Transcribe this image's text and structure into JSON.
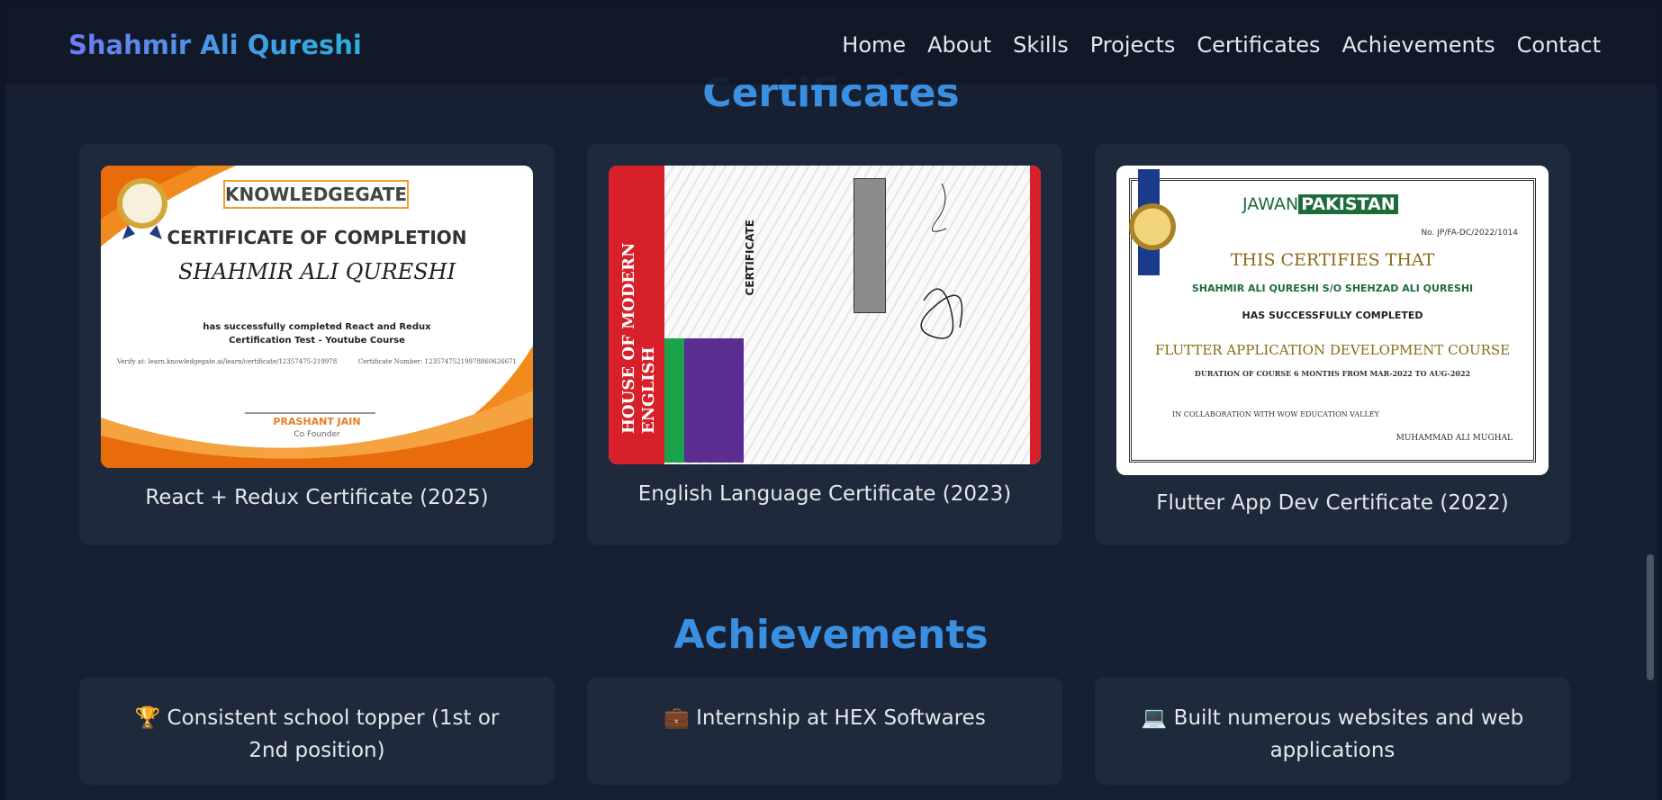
{
  "navbar": {
    "brand": "Shahmir Ali Qureshi",
    "links": [
      "Home",
      "About",
      "Skills",
      "Projects",
      "Certificates",
      "Achievements",
      "Contact"
    ]
  },
  "certificates": {
    "title": "Certificates",
    "items": [
      {
        "caption": "React + Redux Certificate (2025)",
        "image": {
          "logo": "KNOWLEDGEGATE",
          "heading": "CERTIFICATE OF COMPLETION",
          "name": "SHAHMIR ALI QURESHI",
          "body": "has successfully completed React and Redux Certification Test - Youtube Course",
          "verify": "Verify at: learn.knowledgegate.ai/learn/certificate/12357475-219978",
          "number": "Certificate Number: 12357475219978860626671",
          "signer": "PRASHANT JAIN",
          "signer_role": "Co Founder"
        }
      },
      {
        "caption": "English Language Certificate (2023)",
        "image": {
          "side_text": "HOUSE OF MODERN ENGLISH",
          "heading": "CERTIFICATE"
        }
      },
      {
        "caption": "Flutter App Dev Certificate (2022)",
        "image": {
          "logo_left": "JAWAN",
          "logo_right": "PAKISTAN",
          "number": "No. JP/FA-DC/2022/1014",
          "heading": "THIS CERTIFIES THAT",
          "name": "SHAHMIR ALI QURESHI  S/O SHEHZAD ALI QURESHI",
          "completed": "HAS SUCCESSFULLY COMPLETED",
          "course": "FLUTTER APPLICATION DEVELOPMENT COURSE",
          "duration": "DURATION OF COURSE  6 MONTHS   FROM  MAR-2022   TO  AUG-2022",
          "collab": "IN COLLABORATION WITH WOW EDUCATION VALLEY",
          "signer": "MUHAMMAD ALI MUGHAL"
        }
      }
    ]
  },
  "achievements": {
    "title": "Achievements",
    "items": [
      {
        "icon": "🏆",
        "text": "Consistent school topper (1st or 2nd position)"
      },
      {
        "icon": "💼",
        "text": "Internship at HEX Softwares"
      },
      {
        "icon": "💻",
        "text": "Built numerous websites and web applications"
      }
    ]
  }
}
